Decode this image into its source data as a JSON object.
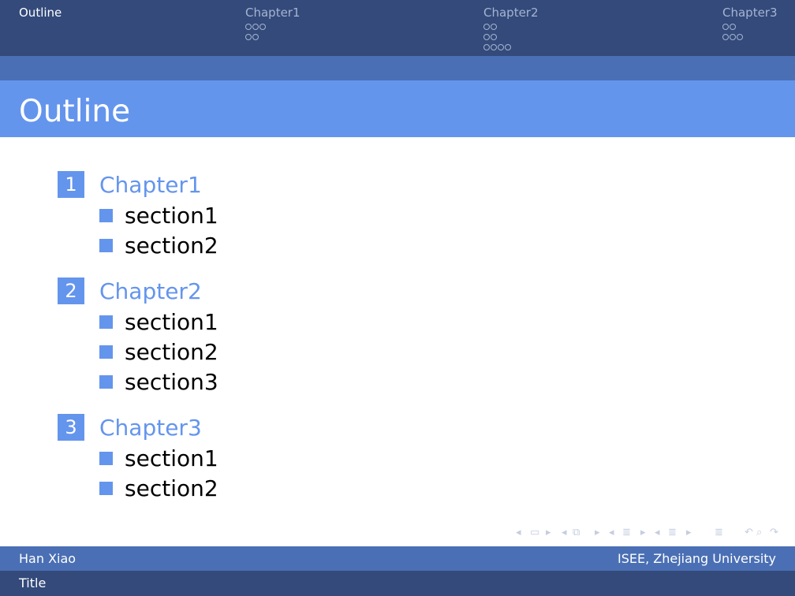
{
  "nav": {
    "items": [
      {
        "label": "Outline",
        "dots": []
      },
      {
        "label": "Chapter1",
        "dots": [
          3,
          2
        ]
      },
      {
        "label": "Chapter2",
        "dots": [
          2,
          2,
          4
        ]
      },
      {
        "label": "Chapter3",
        "dots": [
          2,
          3
        ]
      }
    ]
  },
  "frame": {
    "title": "Outline"
  },
  "toc": {
    "chapters": [
      {
        "number": "1",
        "title": "Chapter1",
        "sections": [
          "section1",
          "section2"
        ]
      },
      {
        "number": "2",
        "title": "Chapter2",
        "sections": [
          "section1",
          "section2",
          "section3"
        ]
      },
      {
        "number": "3",
        "title": "Chapter3",
        "sections": [
          "section1",
          "section2"
        ]
      }
    ]
  },
  "footer": {
    "author": "Han Xiao",
    "institute": "ISEE, Zhejiang University",
    "title": "Title"
  },
  "colors": {
    "accent": "#6495ed",
    "header": "#334a7a",
    "mid": "#4a6fb4"
  }
}
